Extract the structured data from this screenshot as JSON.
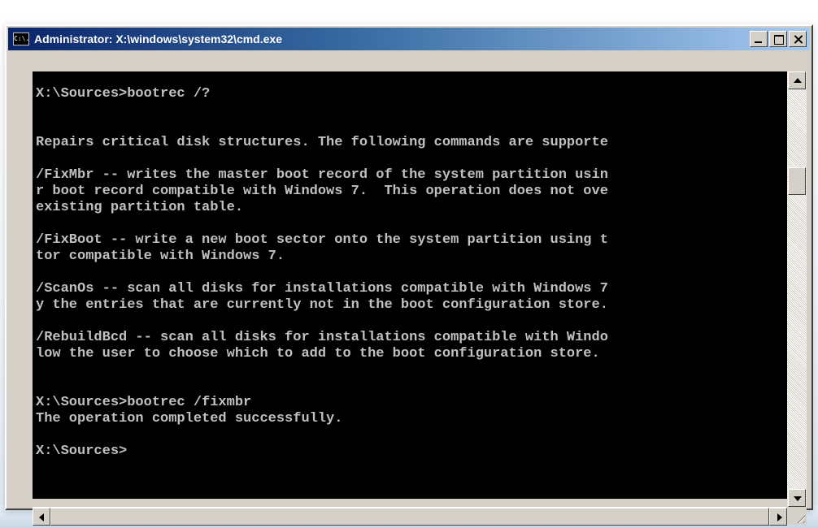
{
  "window": {
    "title": "Administrator: X:\\windows\\system32\\cmd.exe",
    "icon_text": "C:\\."
  },
  "console": {
    "lines": [
      "X:\\Sources>bootrec /?",
      "",
      "",
      "Repairs critical disk structures. The following commands are supporte",
      "",
      "/FixMbr -- writes the master boot record of the system partition usin",
      "r boot record compatible with Windows 7.  This operation does not ove",
      "existing partition table.",
      "",
      "/FixBoot -- write a new boot sector onto the system partition using t",
      "tor compatible with Windows 7.",
      "",
      "/ScanOs -- scan all disks for installations compatible with Windows 7",
      "y the entries that are currently not in the boot configuration store.",
      "",
      "/RebuildBcd -- scan all disks for installations compatible with Windo",
      "low the user to choose which to add to the boot configuration store.",
      "",
      "",
      "X:\\Sources>bootrec /fixmbr",
      "The operation completed successfully.",
      "",
      "X:\\Sources>"
    ]
  },
  "icons": {
    "window_icon": "cmd-icon",
    "minimize": "minimize-icon",
    "maximize": "maximize-icon",
    "close": "close-icon",
    "scroll_up": "arrow-up-icon",
    "scroll_down": "arrow-down-icon",
    "scroll_left": "arrow-left-icon",
    "scroll_right": "arrow-right-icon"
  },
  "colors": {
    "console_background": "#000000",
    "console_text": "#c0c0c0",
    "titlebar_start": "#0a246a",
    "titlebar_end": "#a6caf0"
  }
}
